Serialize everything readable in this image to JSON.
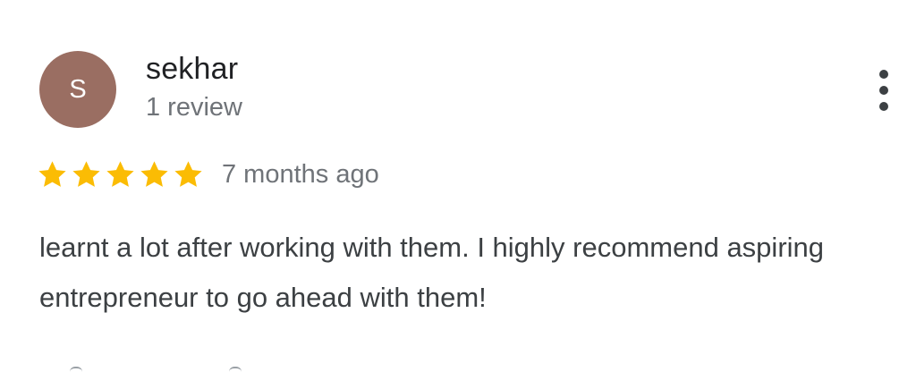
{
  "review": {
    "avatar_initial": "S",
    "avatar_color": "#9a6e62",
    "reviewer_name": "sekhar",
    "review_count": "1 review",
    "rating": 5,
    "rating_max": 5,
    "star_color": "#fbbc04",
    "time_ago": "7 months ago",
    "text": "learnt a lot after working with them. I highly recommend aspiring entrepreneur to go ahead with them!",
    "menu_icon": "more-vert-icon"
  }
}
